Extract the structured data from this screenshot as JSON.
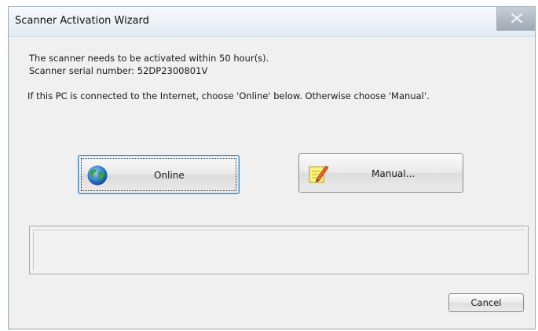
{
  "window": {
    "title": "Scanner Activation Wizard"
  },
  "message": {
    "line1": "The scanner needs to be activated within 50 hour(s).",
    "line2": "Scanner serial number: 52DP2300801V",
    "line3": "If this PC is connected to the Internet, choose 'Online' below. Otherwise choose 'Manual'."
  },
  "buttons": {
    "online": {
      "label": "Online",
      "icon": "globe-icon"
    },
    "manual": {
      "label": "Manual...",
      "icon": "notepad-pencil-icon"
    },
    "cancel": {
      "label": "Cancel"
    }
  },
  "status": {
    "text": ""
  }
}
